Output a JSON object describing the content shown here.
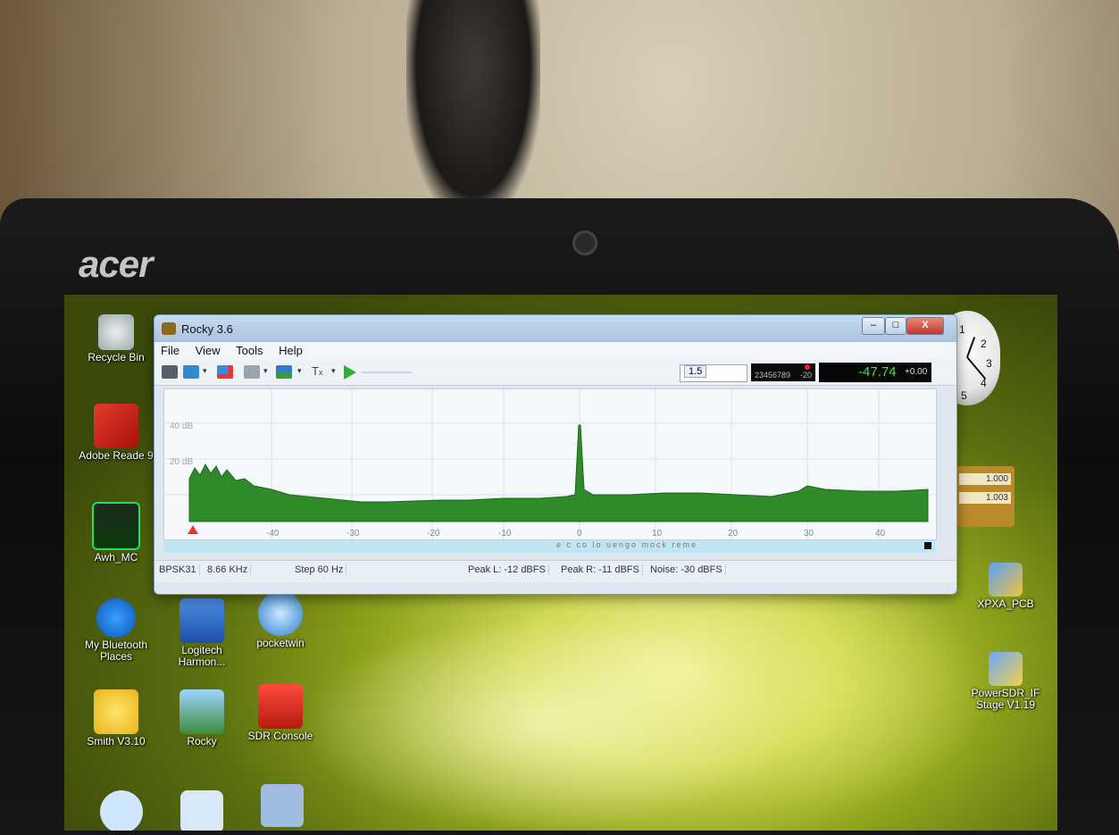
{
  "laptop": {
    "brand": "acer"
  },
  "desktop_icons": [
    {
      "label": "Recycle Bin",
      "icon": "recycle-bin-icon"
    },
    {
      "label": "Adobe Reade 9",
      "icon": "adobe-reader-icon"
    },
    {
      "label": "Awh_MC",
      "icon": "chart-app-icon"
    },
    {
      "label": "My Bluetooth Places",
      "icon": "bluetooth-icon"
    },
    {
      "label": "Logitech Harmon...",
      "icon": "harmony-remote-icon"
    },
    {
      "label": "pocketwin",
      "icon": "pocketwin-icon"
    },
    {
      "label": "Smith V3.10",
      "icon": "smith-chart-icon"
    },
    {
      "label": "Rocky",
      "icon": "rocky-app-icon"
    },
    {
      "label": "SDR Console",
      "icon": "sdr-console-icon"
    },
    {
      "label": "XPXA_PCB",
      "icon": "xpxa-pcb-icon"
    },
    {
      "label": "PowerSDR_IF Stage V1.19",
      "icon": "powersdr-icon"
    }
  ],
  "clock": {
    "numbers": [
      "1",
      "2",
      "3",
      "4",
      "5"
    ]
  },
  "gadget": {
    "values": [
      "1.000",
      "1.003"
    ]
  },
  "window": {
    "title": "Rocky 3.6",
    "controls": {
      "minimize": "–",
      "maximize": "□",
      "close": "X"
    },
    "menu": [
      "File",
      "View",
      "Tools",
      "Help"
    ],
    "toolbar": {
      "icons": [
        "soundcard-icon",
        "monitor-icon",
        "record-icon",
        "keyboard-icon",
        "af-icon",
        "tx-icon",
        "play-icon"
      ],
      "freq_field": "1.5",
      "rx_digits": "23456789",
      "rx_offset": "-20",
      "level": "-47.74",
      "level_offset": "+0.00"
    },
    "spectrum": {
      "db_labels": [
        "40 dB",
        "20 dB"
      ],
      "x_labels": [
        "-40",
        "-30",
        "-20",
        "-10",
        "0",
        "10",
        "20",
        "30",
        "40"
      ]
    },
    "waterfall_text": "e c   co   lo  uengo  mock  reme",
    "status": {
      "mode": "BPSK31",
      "freq": "8.66 KHz",
      "step": "Step 60 Hz",
      "peak_l": "Peak L: -12 dBFS",
      "peak_r": "Peak R: -11 dBFS",
      "noise": "Noise: -30 dBFS"
    }
  }
}
